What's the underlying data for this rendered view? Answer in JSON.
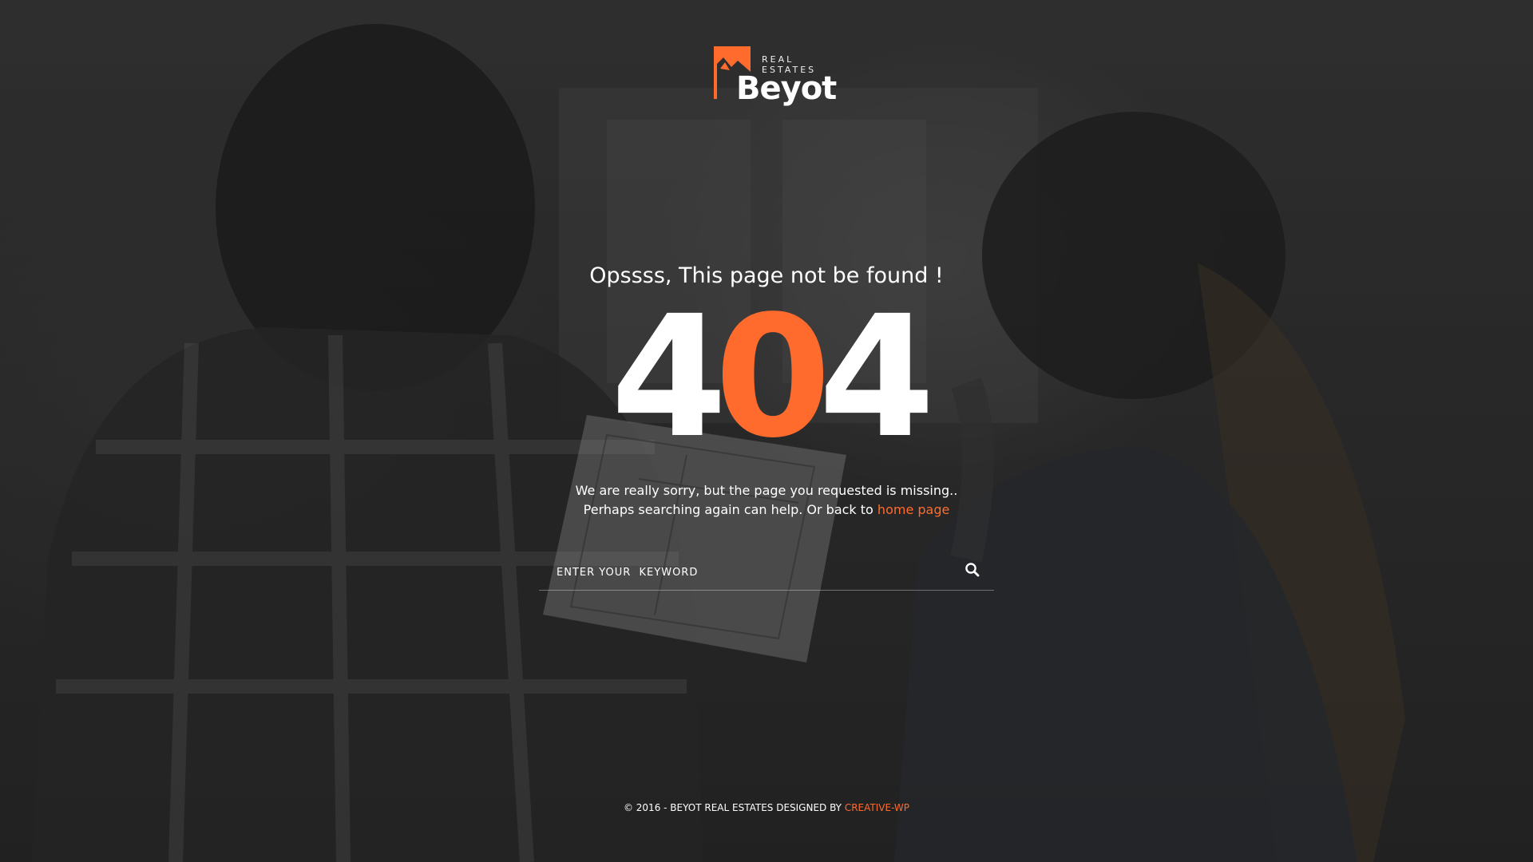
{
  "brand": {
    "logo_small": "REAL\nESTATES",
    "logo_name": "Beyot",
    "accent_color": "#ff6b2c"
  },
  "error": {
    "heading": "Opssss, This page not be found !",
    "code_first": "4",
    "code_middle": "0",
    "code_last": "4",
    "message_line1": "We are really sorry, but the page you requested is missing..",
    "message_line2_prefix": "Perhaps searching again can help. Or back to ",
    "home_link": "home page"
  },
  "search": {
    "placeholder": "ENTER YOUR  KEYWORD",
    "icon": "search-icon"
  },
  "footer": {
    "copyright_prefix": "© 2016 - BEYOT REAL ESTATES DESIGNED BY ",
    "designer_link": "CREATIVE-WP"
  }
}
